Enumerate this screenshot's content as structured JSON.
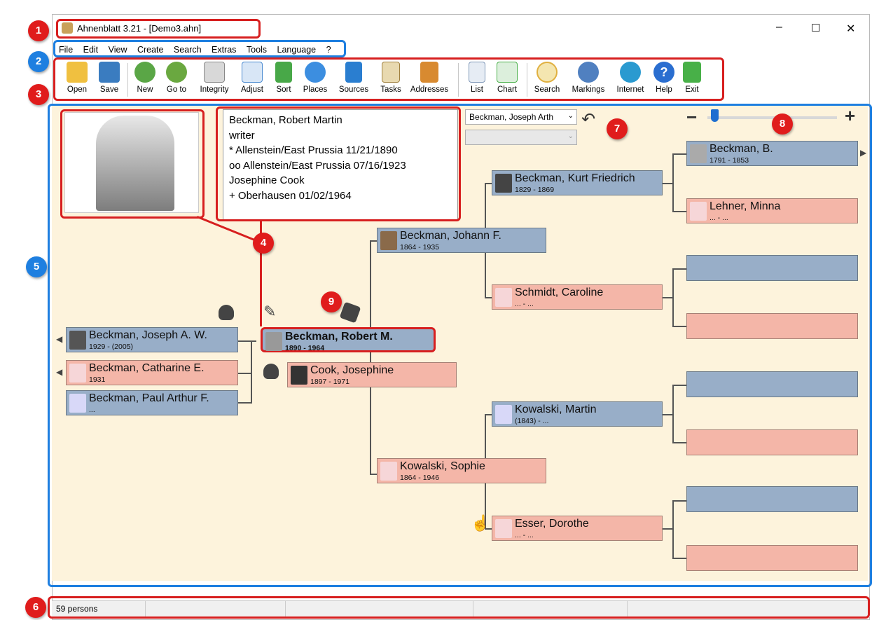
{
  "window": {
    "title": "Ahnenblatt 3.21 - [Demo3.ahn]",
    "min_glyph": "–",
    "max_glyph": "☐",
    "close_glyph": "✕"
  },
  "menu": [
    "File",
    "Edit",
    "View",
    "Create",
    "Search",
    "Extras",
    "Tools",
    "Language",
    "?"
  ],
  "toolbar": [
    {
      "label": "Open",
      "icon": "open-folder-icon",
      "color": "#f0c040"
    },
    {
      "label": "Save",
      "icon": "save-disk-icon",
      "color": "#3a7cc0"
    },
    {
      "label": "New",
      "icon": "new-person-icon",
      "color": "#5aa646"
    },
    {
      "label": "Go to",
      "icon": "goto-person-icon",
      "color": "#6aa840"
    },
    {
      "label": "Integrity",
      "icon": "integrity-checklist-icon",
      "color": "#b0b0b0"
    },
    {
      "label": "Adjust",
      "icon": "adjust-ab-icon",
      "color": "#4a8ad0"
    },
    {
      "label": "Sort",
      "icon": "sort-icon",
      "color": "#48a848"
    },
    {
      "label": "Places",
      "icon": "globe-icon",
      "color": "#3c8ee0"
    },
    {
      "label": "Sources",
      "icon": "book-icon",
      "color": "#2a7ed0"
    },
    {
      "label": "Tasks",
      "icon": "tasks-clipboard-icon",
      "color": "#c8a868"
    },
    {
      "label": "Addresses",
      "icon": "address-book-icon",
      "color": "#d88a30"
    },
    {
      "label": "List",
      "icon": "list-icon",
      "color": "#8098b8"
    },
    {
      "label": "Chart",
      "icon": "chart-tree-icon",
      "color": "#4ab04a"
    },
    {
      "label": "Search",
      "icon": "search-magnifier-icon",
      "color": "#e0b040"
    },
    {
      "label": "Markings",
      "icon": "markings-icon",
      "color": "#5080c0"
    },
    {
      "label": "Internet",
      "icon": "internet-globe-icon",
      "color": "#2a9ad0"
    },
    {
      "label": "Help",
      "icon": "help-icon",
      "color": "#2a6ed0"
    },
    {
      "label": "Exit",
      "icon": "exit-icon",
      "color": "#48b048"
    }
  ],
  "info": {
    "lines": [
      "Beckman, Robert Martin",
      "writer",
      "* Allenstein/East Prussia 11/21/1890",
      "oo Allenstein/East Prussia 07/16/1923",
      "Josephine Cook",
      "+ Oberhausen 01/02/1964"
    ]
  },
  "partner_select": {
    "value": "Beckman, Joseph Arth"
  },
  "persons": {
    "proband": {
      "name": "Beckman, Robert M.",
      "years": "1890 - 1964"
    },
    "spouse": {
      "name": "Cook, Josephine",
      "years": "1897 - 1971"
    },
    "child1": {
      "name": "Beckman, Joseph A. W.",
      "years": "1929 - (2005)"
    },
    "child2": {
      "name": "Beckman, Catharine E.",
      "years": "1931"
    },
    "child3": {
      "name": "Beckman, Paul Arthur F.",
      "years": "..."
    },
    "father": {
      "name": "Beckman, Johann F.",
      "years": "1864 - 1935"
    },
    "mother": {
      "name": "Kowalski, Sophie",
      "years": "1864 - 1946"
    },
    "pgf": {
      "name": "Beckman, Kurt Friedrich",
      "years": "1829 - 1869"
    },
    "pgm": {
      "name": "Schmidt, Caroline",
      "years": "... - ..."
    },
    "mgf": {
      "name": "Kowalski, Martin",
      "years": "(1843) - ..."
    },
    "mgm": {
      "name": "Esser, Dorothe",
      "years": "... - ..."
    },
    "ggf": {
      "name": "Beckman, B.",
      "years": "1791 - 1853"
    },
    "ggm": {
      "name": "Lehner, Minna",
      "years": "... - ..."
    }
  },
  "status": {
    "count": "59 persons"
  },
  "callouts": [
    "1",
    "2",
    "3",
    "4",
    "5",
    "6",
    "7",
    "8",
    "9"
  ]
}
